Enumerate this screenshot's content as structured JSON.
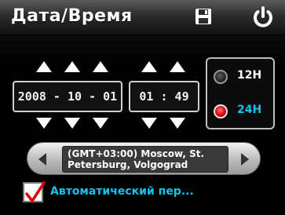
{
  "header": {
    "title": "Дата/Время",
    "save_icon": "save-icon",
    "power_icon": "power-icon"
  },
  "date": {
    "value": "2008 - 10 - 01"
  },
  "time": {
    "value": "01 : 49"
  },
  "time_format": {
    "options": [
      {
        "label": "12H",
        "selected": false,
        "color": "#ffffff"
      },
      {
        "label": "24H",
        "selected": true,
        "color": "#19c1ea"
      }
    ]
  },
  "timezone": {
    "value": "(GMT+03:00) Moscow, St. Petersburg, Volgograd"
  },
  "auto": {
    "label": "Автоматический пер...",
    "checked": true
  },
  "colors": {
    "accent": "#19c1ea",
    "radio_on": "#e00000",
    "check": "#e00000"
  }
}
